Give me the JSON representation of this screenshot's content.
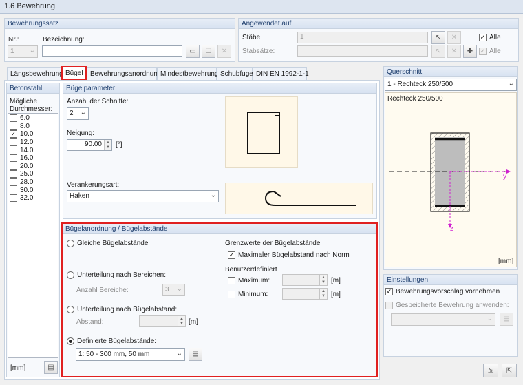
{
  "window": {
    "title": "1.6 Bewehrung"
  },
  "bewehrungssatz": {
    "header": "Bewehrungssatz",
    "nr_label": "Nr.:",
    "nr_value": "1",
    "bezeichnung_label": "Bezeichnung:",
    "bezeichnung_value": ""
  },
  "angewendet": {
    "header": "Angewendet auf",
    "staebe_label": "Stäbe:",
    "staebe_value": "1",
    "stabsaetze_label": "Stabsätze:",
    "stabsaetze_value": "",
    "alle_label": "Alle",
    "alle2_label": "Alle"
  },
  "tabs": [
    {
      "label": "Längsbewehrung"
    },
    {
      "label": "Bügel"
    },
    {
      "label": "Bewehrungsanordnung"
    },
    {
      "label": "Mindestbewehrung"
    },
    {
      "label": "Schubfuge"
    },
    {
      "label": "DIN EN 1992-1-1"
    }
  ],
  "betonstahl": {
    "header": "Betonstahl",
    "label_line1": "Mögliche",
    "label_line2": "Durchmesser:",
    "diameters": [
      {
        "value": "6.0",
        "checked": false
      },
      {
        "value": "8.0",
        "checked": false
      },
      {
        "value": "10.0",
        "checked": true
      },
      {
        "value": "12.0",
        "checked": false
      },
      {
        "value": "14.0",
        "checked": false
      },
      {
        "value": "16.0",
        "checked": false
      },
      {
        "value": "20.0",
        "checked": false
      },
      {
        "value": "25.0",
        "checked": false
      },
      {
        "value": "28.0",
        "checked": false
      },
      {
        "value": "30.0",
        "checked": false
      },
      {
        "value": "32.0",
        "checked": false
      }
    ],
    "unit": "[mm]"
  },
  "buegelparameter": {
    "header": "Bügelparameter",
    "schnitte_label": "Anzahl der Schnitte:",
    "schnitte_value": "2",
    "neigung_label": "Neigung:",
    "neigung_value": "90.00",
    "neigung_unit": "[°]",
    "verankerung_label": "Verankerungsart:",
    "verankerung_value": "Haken"
  },
  "anordnung": {
    "header": "Bügelanordnung / Bügelabstände",
    "opt_gleich": "Gleiche Bügelabstände",
    "opt_bereiche": "Unterteilung nach Bereichen:",
    "anzahl_bereiche_label": "Anzahl Bereiche:",
    "anzahl_bereiche_value": "3",
    "opt_abstand": "Unterteilung nach Bügelabstand:",
    "abstand_label": "Abstand:",
    "abstand_value": "",
    "abstand_unit": "[m]",
    "opt_definiert": "Definierte Bügelabstände:",
    "definiert_value": "1: 50 - 300 mm, 50 mm",
    "grenz_header": "Grenzwerte der Bügelabstände",
    "max_norm_label": "Maximaler Bügelabstand nach Norm",
    "benutzer_label": "Benutzerdefiniert",
    "maximum_label": "Maximum:",
    "minimum_label": "Minimum:",
    "unit_m1": "[m]",
    "unit_m2": "[m]"
  },
  "querschnitt": {
    "header": "Querschnitt",
    "combo_value": "1 - Rechteck 250/500",
    "caption": "Rechteck 250/500",
    "axis_y": "y",
    "axis_z": "z",
    "unit": "[mm]"
  },
  "einstellungen": {
    "header": "Einstellungen",
    "vorschlag_label": "Bewehrungsvorschlag vornehmen",
    "gespeichert_label": "Gespeicherte Bewehrung anwenden:"
  },
  "colors": {
    "highlight": "#e02020",
    "axis": "#d020d0",
    "header_text": "#1f3f6e"
  }
}
